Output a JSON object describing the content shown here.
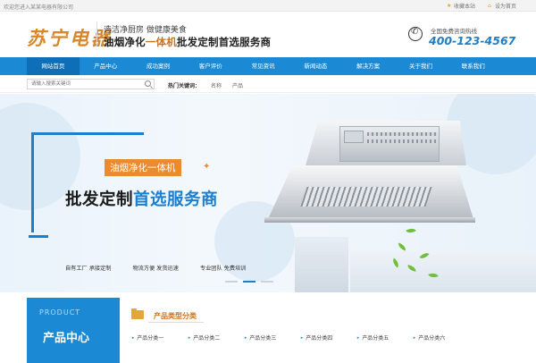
{
  "topbar": {
    "welcome": "欢迎您进入某某电器有限公司",
    "favorite": "收藏本站",
    "homepage": "设为首页"
  },
  "header": {
    "logo": "苏宁电器",
    "slogan_line1": "造洁净厨房 做健康美食",
    "slogan_line2_a": "油烟净化",
    "slogan_line2_hl": "一体机",
    "slogan_line2_b": "批发定制首选服务商",
    "hotline_label": "全国免费咨询热线",
    "hotline_number": "400-123-4567"
  },
  "nav": {
    "items": [
      "网站首页",
      "产品中心",
      "成功案例",
      "客户评价",
      "常见资讯",
      "新闻动态",
      "解决方案",
      "关于我们",
      "联系我们"
    ],
    "active_index": 0
  },
  "search": {
    "placeholder": "请输入搜索关键词",
    "hotkeys_label": "热门关键词：",
    "hotkeys": [
      "名称",
      "产品"
    ]
  },
  "banner": {
    "tag": "油烟净化一体机",
    "title_a": "批发定制",
    "title_b": "首选服务商",
    "features": [
      "自有工厂 承接定制",
      "物流方便 发货迅速",
      "专业团队 免费培训"
    ],
    "slide_count": 3,
    "active_slide": 1
  },
  "products": {
    "box_en": "PRODUCT",
    "box_cn": "产品中心",
    "category_title": "产品类型分类",
    "categories": [
      "产品分类一",
      "产品分类二",
      "产品分类三",
      "产品分类四",
      "产品分类五",
      "产品分类六"
    ]
  },
  "colors": {
    "primary": "#1b89d3",
    "accent": "#ec8b2b",
    "hotline": "#1f7dc4"
  }
}
